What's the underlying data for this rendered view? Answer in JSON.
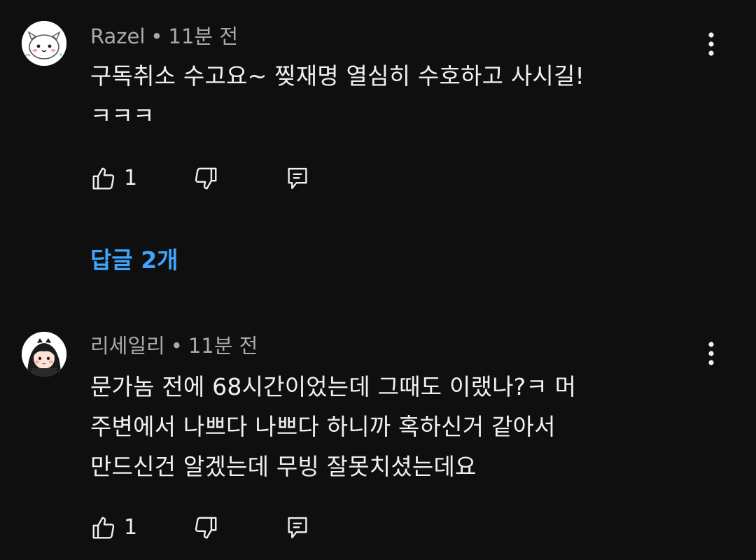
{
  "comments": [
    {
      "author": "Razel",
      "separator": "•",
      "time": "11분 전",
      "text": "구독취소 수고요~ 찢재명 열심히 수호하고 사시길!\nㅋㅋㅋ",
      "like_count": "1",
      "replies_label": "답글 2개",
      "avatar_icon": "cute-white-creature-avatar"
    },
    {
      "author": "리세일리",
      "separator": "•",
      "time": "11분 전",
      "text": "문가놈 전에 68시간이었는데 그때도 이랬나?ㅋ 머\n주변에서 나쁘다 나쁘다 하니까 혹하신거 같아서\n만드신건 알겠는데 무빙 잘못치셨는데요",
      "like_count": "1",
      "avatar_icon": "cartoon-girl-avatar"
    }
  ],
  "colors": {
    "background": "#0f0f0f",
    "text_primary": "#f1f1f1",
    "text_secondary": "#aaaaaa",
    "link_blue": "#3ea6ff"
  }
}
